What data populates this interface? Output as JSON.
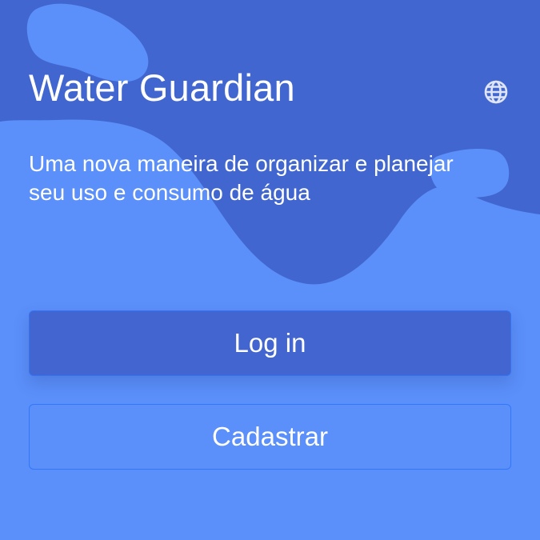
{
  "colors": {
    "background": "#5b8ff9",
    "wave": "#4166cf",
    "primary_button": "#4265cf",
    "text": "#ffffff",
    "globe_icon": "#dfe5f4"
  },
  "header": {
    "title": "Water Guardian",
    "language_icon": "globe-icon"
  },
  "hero": {
    "tagline": "Uma nova maneira de organizar e planejar seu uso e consumo de água"
  },
  "actions": {
    "login_label": "Log in",
    "signup_label": "Cadastrar"
  }
}
